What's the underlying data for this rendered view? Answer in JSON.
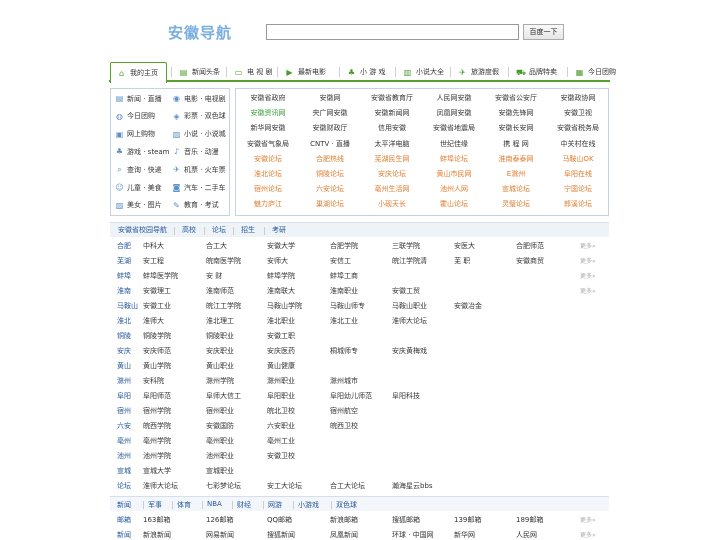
{
  "header": {
    "logo": "安徽导航",
    "search_value": "",
    "search_button": "百度一下"
  },
  "nav": {
    "tabs": [
      {
        "label": "我的主页",
        "icon": "home-icon",
        "active": true
      },
      {
        "label": "新闻头条",
        "icon": "news-icon"
      },
      {
        "label": "电 视 剧",
        "icon": "tv-icon"
      },
      {
        "label": "最新电影",
        "icon": "movie-icon"
      },
      {
        "label": "小 游 戏",
        "icon": "game-icon"
      },
      {
        "label": "小说大全",
        "icon": "book-icon"
      },
      {
        "label": "旅游度假",
        "icon": "travel-icon"
      },
      {
        "label": "品牌特卖",
        "icon": "cart-icon"
      },
      {
        "label": "今日团购",
        "icon": "calendar-icon"
      }
    ]
  },
  "left_links": [
    [
      "新闻 · 直播",
      "电影 · 电视剧"
    ],
    [
      "今日团购",
      "彩票 · 双色球"
    ],
    [
      "网上购物",
      "小说 · 小说城"
    ],
    [
      "游戏 · steam",
      "音乐 · 动漫"
    ],
    [
      "查询 · 快递",
      "机票 · 火车票"
    ],
    [
      "儿童 · 美食",
      "汽车 · 二手车"
    ],
    [
      "美女 · 图片",
      "教育 · 考试"
    ]
  ],
  "left_icons": [
    [
      "news-icon",
      "film-icon"
    ],
    [
      "group-icon",
      "lottery-icon"
    ],
    [
      "shop-icon",
      "novel-icon"
    ],
    [
      "game-icon",
      "music-icon"
    ],
    [
      "search-icon",
      "plane-icon"
    ],
    [
      "child-icon",
      "car-icon"
    ],
    [
      "photo-icon",
      "edu-icon"
    ]
  ],
  "sites": {
    "rows": [
      [
        {
          "t": "安徽省政府",
          "c": ""
        },
        {
          "t": "安徽网",
          "c": ""
        },
        {
          "t": "安徽省教育厅",
          "c": ""
        },
        {
          "t": "人民网安徽",
          "c": ""
        },
        {
          "t": "安徽省公安厅",
          "c": ""
        },
        {
          "t": "安徽政协网",
          "c": ""
        }
      ],
      [
        {
          "t": "安徽资讯网",
          "c": "green"
        },
        {
          "t": "央广网安徽",
          "c": ""
        },
        {
          "t": "安徽新闻网",
          "c": ""
        },
        {
          "t": "凤凰网安徽",
          "c": ""
        },
        {
          "t": "安徽先锋网",
          "c": ""
        },
        {
          "t": "安徽卫视",
          "c": ""
        }
      ],
      [
        {
          "t": "新华网安徽",
          "c": ""
        },
        {
          "t": "安徽财政厅",
          "c": ""
        },
        {
          "t": "信用安徽",
          "c": ""
        },
        {
          "t": "安徽省地震局",
          "c": ""
        },
        {
          "t": "安徽长安网",
          "c": ""
        },
        {
          "t": "安徽省税务局",
          "c": ""
        }
      ],
      [
        {
          "t": "安徽省气象局",
          "c": ""
        },
        {
          "t": "CNTV · 直播",
          "c": ""
        },
        {
          "t": "太平洋电脑",
          "c": ""
        },
        {
          "t": "世纪佳缘",
          "c": ""
        },
        {
          "t": "携 程 网",
          "c": ""
        },
        {
          "t": "中关村在线",
          "c": ""
        }
      ],
      [
        {
          "t": "安徽论坛",
          "c": "orange"
        },
        {
          "t": "合肥热线",
          "c": "orange"
        },
        {
          "t": "芜湖民生网",
          "c": "orange"
        },
        {
          "t": "蚌埠论坛",
          "c": "orange"
        },
        {
          "t": "淮南泰泰网",
          "c": "orange"
        },
        {
          "t": "马鞍山OK",
          "c": "orange"
        }
      ],
      [
        {
          "t": "淮北论坛",
          "c": "orange"
        },
        {
          "t": "铜陵论坛",
          "c": "orange"
        },
        {
          "t": "安庆论坛",
          "c": "orange"
        },
        {
          "t": "黄山市民网",
          "c": "orange"
        },
        {
          "t": "E滁州",
          "c": "orange"
        },
        {
          "t": "阜阳在线",
          "c": "orange"
        }
      ],
      [
        {
          "t": "宿州论坛",
          "c": "orange"
        },
        {
          "t": "六安论坛",
          "c": "orange"
        },
        {
          "t": "亳州生活网",
          "c": "orange"
        },
        {
          "t": "池州人网",
          "c": "orange"
        },
        {
          "t": "宣城论坛",
          "c": "orange"
        },
        {
          "t": "宁国论坛",
          "c": "orange"
        }
      ],
      [
        {
          "t": "魅力庐江",
          "c": "orange"
        },
        {
          "t": "巢湖论坛",
          "c": "orange"
        },
        {
          "t": "小砚天长",
          "c": "orange"
        },
        {
          "t": "霍山论坛",
          "c": "orange"
        },
        {
          "t": "灵璧论坛",
          "c": "orange"
        },
        {
          "t": "郎溪论坛",
          "c": "orange"
        }
      ]
    ]
  },
  "school_tabs": [
    "安徽省校园导航",
    "高校",
    "论坛",
    "招生",
    "考研"
  ],
  "more_label": "更多»",
  "school_rows": [
    {
      "city": "合肥",
      "items": [
        "中科大",
        "合工大",
        "安徽大学",
        "合肥学院",
        "三联学院",
        "安医大",
        "合肥师范"
      ],
      "more": true
    },
    {
      "city": "芜湖",
      "items": [
        "安工程",
        "皖南医学院",
        "安师大",
        "安信工",
        "皖江学院清",
        "芜 职",
        "安徽商贸"
      ],
      "more": true
    },
    {
      "city": "蚌埠",
      "items": [
        "蚌埠医学院",
        "安 财",
        "蚌埠学院",
        "蚌埠工商"
      ],
      "more": true
    },
    {
      "city": "淮南",
      "items": [
        "安徽理工",
        "淮南师范",
        "淮南联大",
        "淮南职业",
        "安徽工贸"
      ],
      "more": true
    },
    {
      "city": "马鞍山",
      "items": [
        "安徽工业",
        "皖江工学院",
        "马鞍山学院",
        "马鞍山师专",
        "马鞍山职业",
        "安徽冶金"
      ],
      "more": false
    },
    {
      "city": "淮北",
      "items": [
        "淮师大",
        "淮北理工",
        "淮北职业",
        "淮北工业",
        "淮师大论坛"
      ],
      "more": false
    },
    {
      "city": "铜陵",
      "items": [
        "铜陵学院",
        "铜陵职业",
        "安徽工职"
      ],
      "more": false
    },
    {
      "city": "安庆",
      "items": [
        "安庆师范",
        "安庆职业",
        "安庆医药",
        "桐城师专",
        "安庆黄梅戏"
      ],
      "more": false
    },
    {
      "city": "黄山",
      "items": [
        "黄山学院",
        "黄山职业",
        "黄山健康"
      ],
      "more": false
    },
    {
      "city": "滁州",
      "items": [
        "安科院",
        "滁州学院",
        "滁州职业",
        "滁州城市"
      ],
      "more": false
    },
    {
      "city": "阜阳",
      "items": [
        "阜阳师范",
        "阜师大信工",
        "阜阳职业",
        "阜阳幼儿师范",
        "阜阳科技"
      ],
      "more": false
    },
    {
      "city": "宿州",
      "items": [
        "宿州学院",
        "宿州职业",
        "皖北卫校",
        "宿州航空"
      ],
      "more": false
    },
    {
      "city": "六安",
      "items": [
        "皖西学院",
        "安徽国防",
        "六安职业",
        "皖西卫校"
      ],
      "more": false
    },
    {
      "city": "亳州",
      "items": [
        "亳州学院",
        "亳州职业",
        "亳州工业"
      ],
      "more": false
    },
    {
      "city": "池州",
      "items": [
        "池州学院",
        "池州职业",
        "安徽卫校"
      ],
      "more": false
    },
    {
      "city": "宣城",
      "items": [
        "宣城大学",
        "宣城职业"
      ],
      "more": false
    },
    {
      "city": "论坛",
      "items": [
        "淮师大论坛",
        "七彩梦论坛",
        "安工大论坛",
        "合工大论坛",
        "瀚海星云bbs"
      ],
      "more": false
    }
  ],
  "bottom_tabs": [
    "新闻",
    "军事",
    "体育",
    "NBA",
    "财经",
    "网游",
    "小游戏",
    "双色球"
  ],
  "bottom_rows": [
    {
      "city": "邮箱",
      "items": [
        "163邮箱",
        "126邮箱",
        "QQ邮箱",
        "新浪邮箱",
        "搜狐邮箱",
        "139邮箱",
        "189邮箱"
      ],
      "more": true
    },
    {
      "city": "新闻",
      "items": [
        "新浪新闻",
        "网易新闻",
        "搜狐新闻",
        "凤凰新闻",
        "环球 · 中国网",
        "新华网",
        "人民网"
      ],
      "more": true
    }
  ]
}
